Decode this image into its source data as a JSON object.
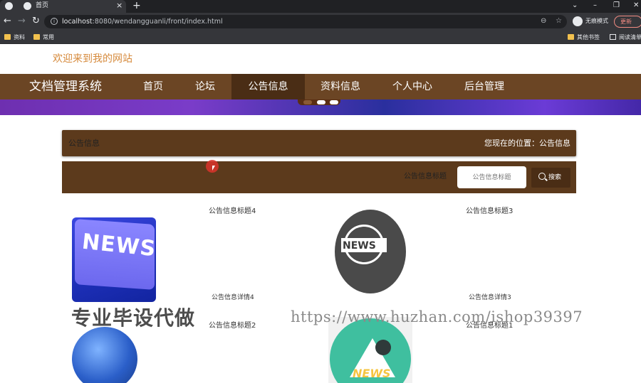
{
  "browser": {
    "tab_title": "首页",
    "tab_close": "×",
    "new_tab": "+",
    "url_host": "localhost",
    "url_path": ":8080/wendangguanli/front/index.html",
    "incognito_label": "无痕模式",
    "update_label": "更新",
    "bookmarks": [
      "资料",
      "常用"
    ],
    "bookmarks_right": [
      "其他书签",
      "阅读清单"
    ],
    "icons": [
      "back-icon",
      "forward-icon",
      "reload-icon",
      "zoom-icon",
      "star-icon"
    ]
  },
  "site": {
    "welcome": "欢迎来到我的网站",
    "brand": "文档管理系统",
    "nav": [
      "首页",
      "论坛",
      "公告信息",
      "资料信息",
      "个人中心",
      "后台管理"
    ],
    "active_nav": "公告信息"
  },
  "breadcrumb": {
    "section": "公告信息",
    "location": "您现在的位置：公告信息"
  },
  "search": {
    "label": "公告信息标题",
    "placeholder": "公告信息标题",
    "button": "搜索"
  },
  "notices": [
    {
      "title": "公告信息标题4",
      "detail": "公告信息详情4",
      "image_text": "NEWS"
    },
    {
      "title": "公告信息标题3",
      "detail": "公告信息详情3",
      "image_text": "NEWS"
    },
    {
      "title": "公告信息标题2",
      "detail": ""
    },
    {
      "title": "公告信息标题1",
      "detail": "",
      "image_text": "NEWS"
    }
  ],
  "watermarks": {
    "left": "专业毕设代做",
    "right": "https://www.huzhan.com/ishop39397"
  },
  "colors": {
    "nav_bg": "#6b4524",
    "nav_active": "#4a2d15",
    "welcome": "#d68a3c"
  }
}
